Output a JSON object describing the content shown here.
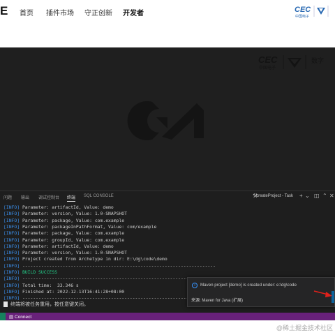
{
  "topnav": {
    "brand": "E",
    "items": [
      "首页",
      "插件市场",
      "守正创新",
      "开发者"
    ],
    "active": "开发者",
    "logo_text": "CEC",
    "logo_sub": "中国电子"
  },
  "splash": {
    "logo_text": "CEC",
    "logo_sub": "中国电子",
    "logo_extra": "数字"
  },
  "panel": {
    "tabs": [
      "问题",
      "输出",
      "调试控制台",
      "终端",
      "SQL CONSOLE"
    ],
    "active_tab": "终端",
    "task": "createProject - Task"
  },
  "terminal": {
    "lines": [
      {
        "tag": "[INFO]",
        "text": " Parameter: artifactId, Value: demo"
      },
      {
        "tag": "[INFO]",
        "text": " Parameter: version, Value: 1.0-SNAPSHOT"
      },
      {
        "tag": "[INFO]",
        "text": " Parameter: package, Value: com.example"
      },
      {
        "tag": "[INFO]",
        "text": " Parameter: packageInPathFormat, Value: com/example"
      },
      {
        "tag": "[INFO]",
        "text": " Parameter: package, Value: com.example"
      },
      {
        "tag": "[INFO]",
        "text": " Parameter: groupId, Value: com.example"
      },
      {
        "tag": "[INFO]",
        "text": " Parameter: artifactId, Value: demo"
      },
      {
        "tag": "[INFO]",
        "text": " Parameter: version, Value: 1.0-SNAPSHOT"
      },
      {
        "tag": "[INFO]",
        "text": " Project created from Archetype in dir: E:\\dg\\code\\demo"
      },
      {
        "tag": "[INFO]",
        "text": " ------------------------------------------------------------------------"
      },
      {
        "tag": "[INFO]",
        "text": " BUILD SUCCESS"
      },
      {
        "tag": "[INFO]",
        "text": " ------------------------------------------------------------------------"
      },
      {
        "tag": "[INFO]",
        "text": " Total time:  33.346 s"
      },
      {
        "tag": "[INFO]",
        "text": " Finished at: 2022-12-13T16:41:28+08:00"
      },
      {
        "tag": "[INFO]",
        "text": " ------------------------------------------------------------------------"
      }
    ],
    "footer": "终端将被任务重用，按任意键关闭。"
  },
  "notification": {
    "message": "Maven project [demo] is created under: e:\\dg\\code",
    "source": "来源: Maven for Java (扩展)"
  },
  "statusbar": {
    "connect": "Connect"
  },
  "watermark": "@稀土掘金技术社区",
  "colors": {
    "statusbar": "#68217a",
    "info": "#3b8eea",
    "success": "#23d18b",
    "accent": "#0e639c"
  }
}
